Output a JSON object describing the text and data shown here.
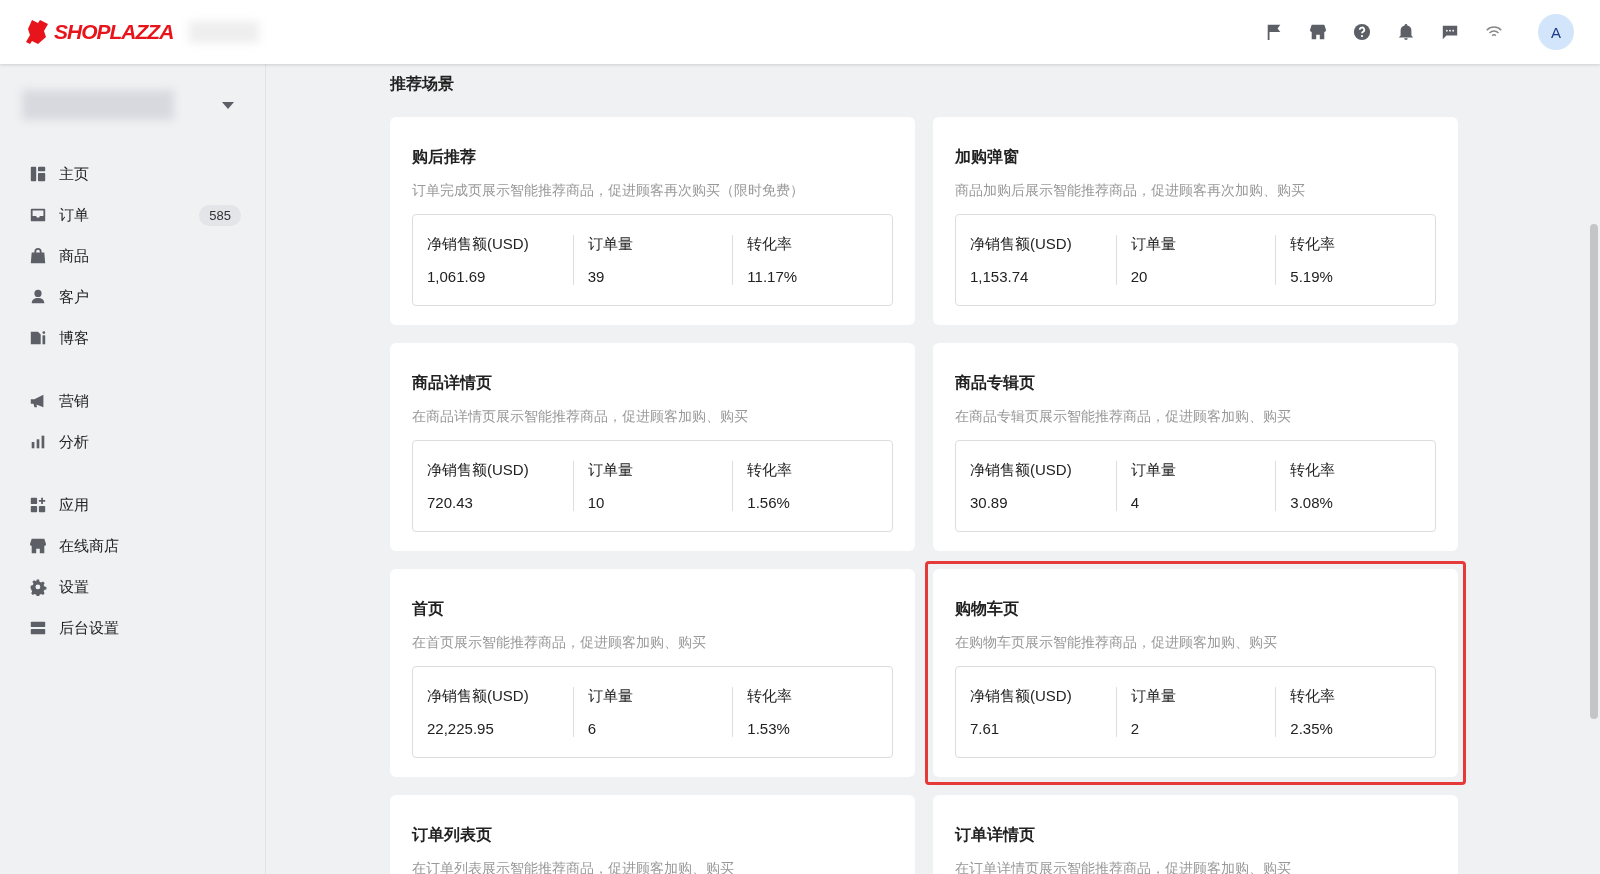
{
  "header": {
    "logo": "SHOPLAZZA",
    "avatar": "A"
  },
  "sidebar": {
    "groups": [
      [
        {
          "label": "主页",
          "selected": false
        },
        {
          "label": "订单",
          "selected": false,
          "count": "585"
        },
        {
          "label": "商品",
          "selected": false
        },
        {
          "label": "客户",
          "selected": false
        },
        {
          "label": "博客",
          "selected": false
        }
      ],
      [
        {
          "label": "营销",
          "selected": false
        },
        {
          "label": "分析",
          "selected": false
        }
      ],
      [
        {
          "label": "应用",
          "selected": false
        },
        {
          "label": "在线商店",
          "selected": false
        },
        {
          "label": "设置",
          "selected": false
        },
        {
          "label": "后台设置",
          "selected": false
        }
      ]
    ]
  },
  "section_title": "推荐场景",
  "cards": [
    {
      "title": "购后推荐",
      "description": "订单完成页展示智能推荐商品，促进顾客再次购买（限时免费）",
      "highlighted": false,
      "stats": [
        {
          "label": "净销售额(USD)",
          "value": "1,061.69"
        },
        {
          "label": "订单量",
          "value": "39"
        },
        {
          "label": "转化率",
          "value": "11.17%"
        }
      ]
    },
    {
      "title": "加购弹窗",
      "description": "商品加购后展示智能推荐商品，促进顾客再次加购、购买",
      "highlighted": false,
      "stats": [
        {
          "label": "净销售额(USD)",
          "value": "1,153.74"
        },
        {
          "label": "订单量",
          "value": "20"
        },
        {
          "label": "转化率",
          "value": "5.19%"
        }
      ]
    },
    {
      "title": "商品详情页",
      "description": "在商品详情页展示智能推荐商品，促进顾客加购、购买",
      "highlighted": false,
      "stats": [
        {
          "label": "净销售额(USD)",
          "value": "720.43"
        },
        {
          "label": "订单量",
          "value": "10"
        },
        {
          "label": "转化率",
          "value": "1.56%"
        }
      ]
    },
    {
      "title": "商品专辑页",
      "description": "在商品专辑页展示智能推荐商品，促进顾客加购、购买",
      "highlighted": false,
      "stats": [
        {
          "label": "净销售额(USD)",
          "value": "30.89"
        },
        {
          "label": "订单量",
          "value": "4"
        },
        {
          "label": "转化率",
          "value": "3.08%"
        }
      ]
    },
    {
      "title": "首页",
      "description": "在首页展示智能推荐商品，促进顾客加购、购买",
      "highlighted": false,
      "stats": [
        {
          "label": "净销售额(USD)",
          "value": "22,225.95"
        },
        {
          "label": "订单量",
          "value": "6"
        },
        {
          "label": "转化率",
          "value": "1.53%"
        }
      ]
    },
    {
      "title": "购物车页",
      "description": "在购物车页展示智能推荐商品，促进顾客加购、购买",
      "highlighted": true,
      "stats": [
        {
          "label": "净销售额(USD)",
          "value": "7.61"
        },
        {
          "label": "订单量",
          "value": "2"
        },
        {
          "label": "转化率",
          "value": "2.35%"
        }
      ]
    },
    {
      "title": "订单列表页",
      "description": "在订单列表展示智能推荐商品，促进顾客加购、购买",
      "highlighted": false
    },
    {
      "title": "订单详情页",
      "description": "在订单详情页展示智能推荐商品，促进顾客加购、购买",
      "highlighted": false
    }
  ]
}
